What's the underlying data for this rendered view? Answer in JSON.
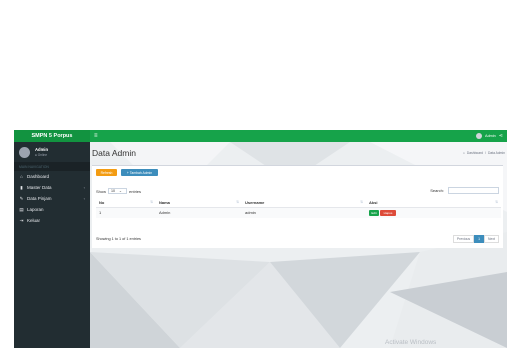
{
  "brand": "SMPN 5 Porpus",
  "topbar": {
    "menu_icon": "≡",
    "user_label": "Admin",
    "share_icon": "share-icon"
  },
  "sidebar": {
    "user_name": "Admin",
    "user_status": "● Online",
    "section_header": "MAIN NAVIGATION",
    "items": [
      {
        "label": "Dashboard",
        "icon": "home-icon",
        "glyph": "⌂",
        "chevron": ""
      },
      {
        "label": "Master Data",
        "icon": "book-icon",
        "glyph": "▮",
        "chevron": "‹"
      },
      {
        "label": "Data Pinjam",
        "icon": "pencil-icon",
        "glyph": "✎",
        "chevron": "‹"
      },
      {
        "label": "Laporan",
        "icon": "file-icon",
        "glyph": "▤",
        "chevron": ""
      },
      {
        "label": "Keluar",
        "icon": "logout-icon",
        "glyph": "⇥",
        "chevron": ""
      }
    ]
  },
  "page": {
    "title": "Data Admin",
    "breadcrumb": [
      "Dashboard",
      "/",
      "Data Admin"
    ]
  },
  "toolbar": {
    "refresh_label": "Refresh",
    "add_label": "+ Tambah Admin"
  },
  "table_controls": {
    "show_label": "Show",
    "entries_value": "10",
    "entries_label": "entries",
    "search_label": "Search:"
  },
  "table": {
    "headers": [
      "No",
      "Nama",
      "Username",
      "Aksi"
    ],
    "rows": [
      {
        "no": "1",
        "nama": "Admin",
        "username": "admin",
        "edit": "Edit",
        "delete": "Hapus"
      }
    ]
  },
  "footer": {
    "info": "Showing 1 to 1 of 1 entries",
    "prev": "Previous",
    "page": "1",
    "next": "Next"
  },
  "watermark": "Activate Windows",
  "colors": {
    "topbar": "#16a34a",
    "sidebar": "#222d32",
    "warning": "#f39c12",
    "info": "#3c8dbc",
    "danger": "#dd4b39"
  }
}
